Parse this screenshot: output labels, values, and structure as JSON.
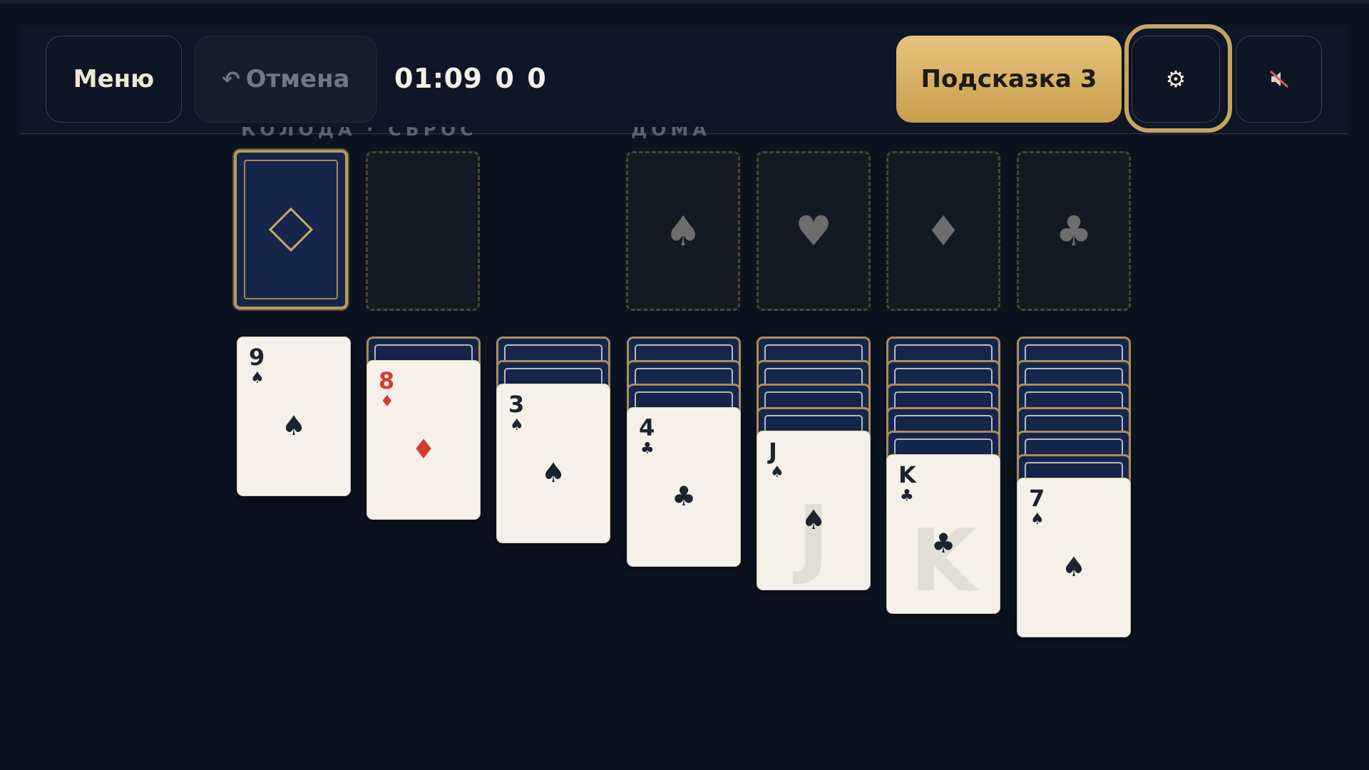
{
  "toolbar": {
    "menu_label": "Меню",
    "undo_icon": "↶",
    "undo_label": "Отмена",
    "timer": "01:09",
    "moves": "0",
    "score": "0",
    "hint_label": "Подсказка",
    "hint_count": "3",
    "settings_icon": "⚙",
    "sound_icon": "🔇"
  },
  "labels": {
    "stock_waste": "КОЛОДА · СБРОС",
    "foundations": "ДОМА"
  },
  "foundations": [
    {
      "suit": "♠",
      "name": "spade"
    },
    {
      "suit": "♥",
      "name": "heart"
    },
    {
      "suit": "♦",
      "name": "diamond"
    },
    {
      "suit": "♣",
      "name": "club"
    }
  ],
  "tableau": [
    {
      "hidden": 0,
      "card": {
        "rank": "9",
        "suit": "♠",
        "color": "black"
      }
    },
    {
      "hidden": 1,
      "card": {
        "rank": "8",
        "suit": "♦",
        "color": "red"
      }
    },
    {
      "hidden": 2,
      "card": {
        "rank": "3",
        "suit": "♠",
        "color": "black"
      }
    },
    {
      "hidden": 3,
      "card": {
        "rank": "4",
        "suit": "♣",
        "color": "black"
      }
    },
    {
      "hidden": 4,
      "card": {
        "rank": "J",
        "suit": "♠",
        "color": "black",
        "face": "J"
      }
    },
    {
      "hidden": 5,
      "card": {
        "rank": "K",
        "suit": "♣",
        "color": "black",
        "face": "K"
      }
    },
    {
      "hidden": 6,
      "card": {
        "rank": "7",
        "suit": "♠",
        "color": "black"
      }
    }
  ],
  "colors": {
    "accent_gold": "#c9a461",
    "table_bg": "#0b1321",
    "card_face": "#f5f1e8",
    "red_suit": "#d43a32"
  }
}
